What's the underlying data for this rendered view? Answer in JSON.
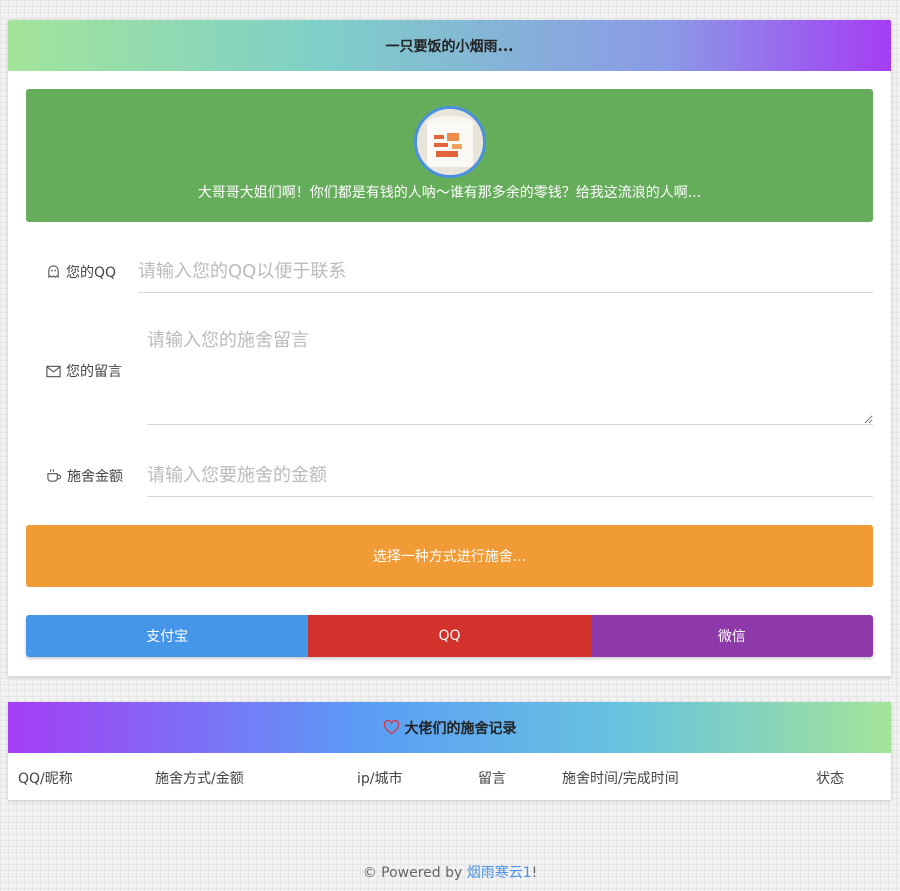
{
  "header": {
    "title": "一只要饭的小烟雨..."
  },
  "banner": {
    "text": "大哥哥大姐们啊！你们都是有钱的人呐～谁有那多余的零钱？给我这流浪的人啊...",
    "avatar_icon": "mug-photo-icon"
  },
  "form": {
    "qq": {
      "label": "您的QQ",
      "placeholder": "请输入您的QQ以便于联系",
      "icon": "ghost-icon"
    },
    "message": {
      "label": "您的留言",
      "placeholder": "请输入您的施舍留言",
      "icon": "envelope-icon"
    },
    "amount": {
      "label": "施舍金额",
      "placeholder": "请输入您要施舍的金额",
      "icon": "coffee-cup-icon"
    }
  },
  "choose_label": "选择一种方式进行施舍...",
  "payments": [
    {
      "label": "支付宝",
      "color": "#4596e9"
    },
    {
      "label": "QQ",
      "color": "#d3312c"
    },
    {
      "label": "微信",
      "color": "#8e39a9"
    }
  ],
  "records": {
    "title": "大佬们的施舍记录",
    "icon": "heart-icon",
    "columns": [
      "QQ/昵称",
      "施舍方式/金额",
      "ip/城市",
      "留言",
      "施舍时间/完成时间",
      "状态"
    ]
  },
  "footer": {
    "prefix": "© Powered by ",
    "link": "烟雨寒云1",
    "suffix": "!"
  },
  "colors": {
    "banner": "#66ad5b",
    "choose": "#f19b37",
    "accent_blue": "#4a90e2"
  }
}
